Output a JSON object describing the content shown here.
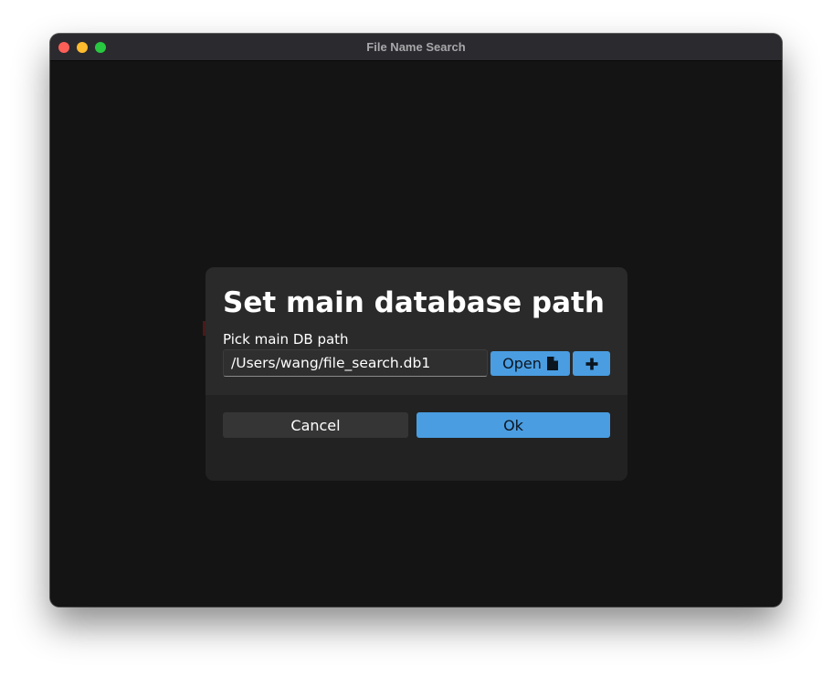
{
  "window": {
    "title": "File Name Search"
  },
  "dialog": {
    "title": "Set main database path",
    "field_label": "Pick main DB path",
    "path_value": "/Users/wang/file_search.db1",
    "open_label": "Open",
    "open_icon": "document-icon",
    "add_icon": "plus-icon",
    "cancel_label": "Cancel",
    "ok_label": "Ok"
  },
  "colors": {
    "accent": "#4a9de1",
    "window_bg": "#141414",
    "dialog_bg": "#2a2a2a",
    "titlebar_bg": "#2b2a2e"
  }
}
